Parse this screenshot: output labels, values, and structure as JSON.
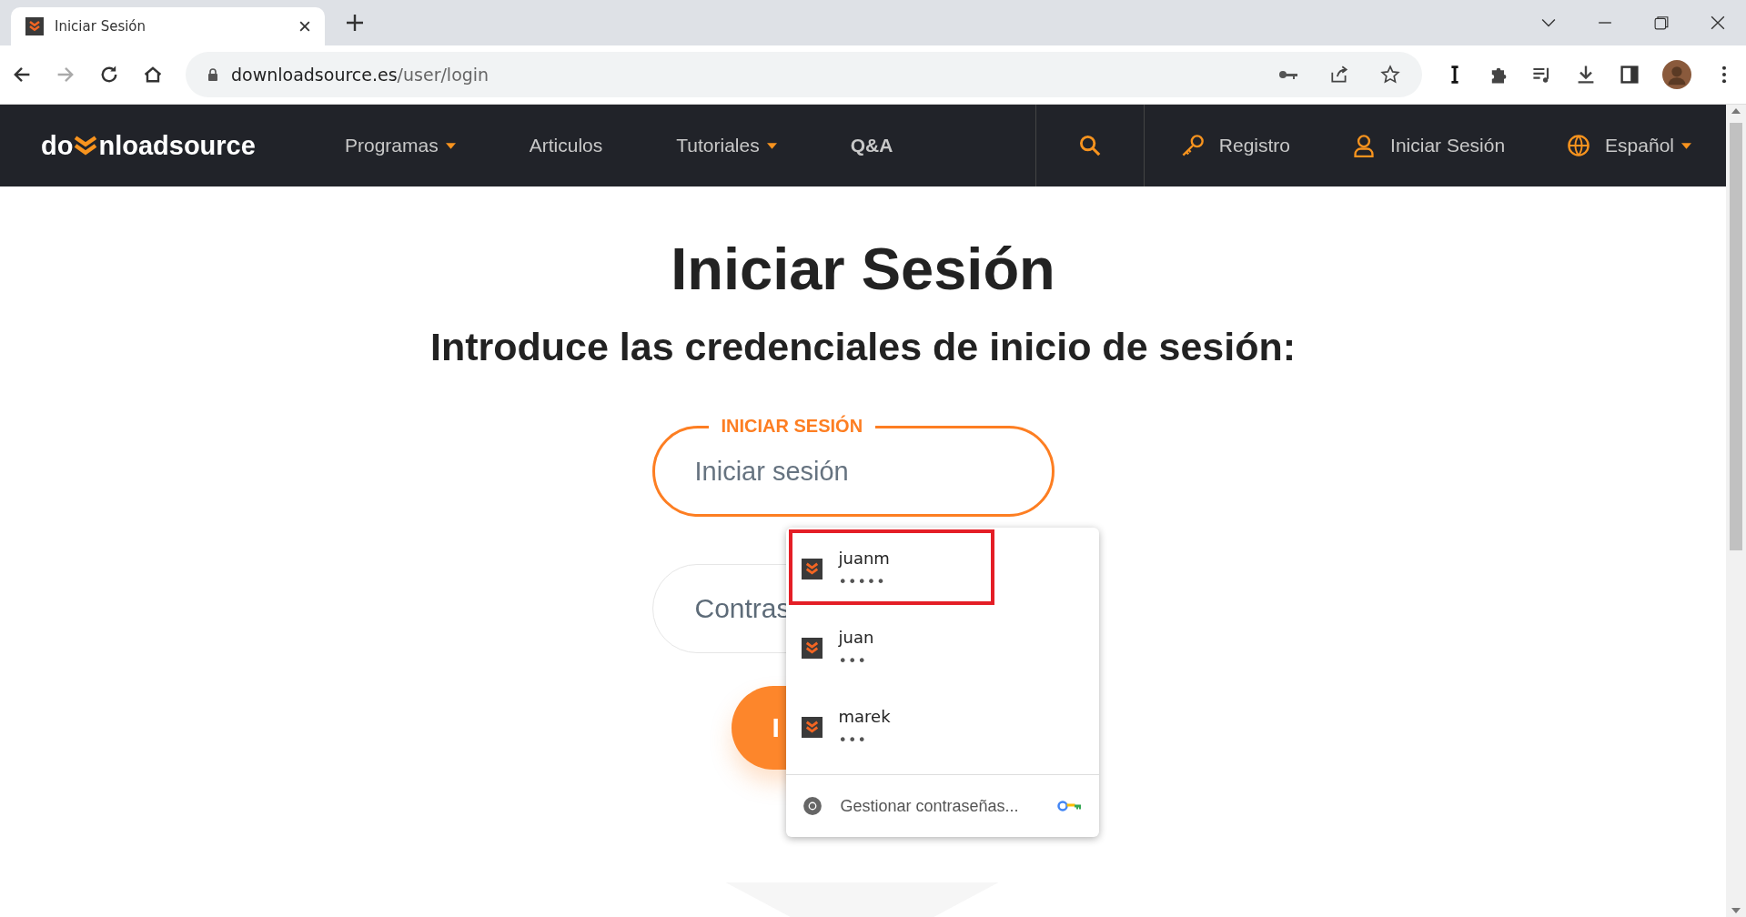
{
  "browser": {
    "tab_title": "Iniciar Sesión",
    "url_host": "downloadsource.es",
    "url_path": "/user/login"
  },
  "nav": {
    "logo_before": "do",
    "logo_after": "nloadsource",
    "items": [
      {
        "label": "Programas",
        "kind": "dropdown"
      },
      {
        "label": "Articulos",
        "kind": "link"
      },
      {
        "label": "Tutoriales",
        "kind": "dropdown"
      },
      {
        "label": "Q&A",
        "kind": "bold"
      }
    ],
    "register": "Registro",
    "login": "Iniciar Sesión",
    "language": "Español"
  },
  "page": {
    "title": "Iniciar Sesión",
    "subtitle": "Introduce las credenciales de inicio de sesión:",
    "login_field": {
      "label": "INICIAR SESIÓN",
      "placeholder": "Iniciar sesión"
    },
    "password_field": {
      "placeholder": "Contras"
    },
    "submit_button": "I"
  },
  "autofill": {
    "suggestions": [
      {
        "username": "juanm",
        "password": "•••••",
        "highlighted": true
      },
      {
        "username": "juan",
        "password": "•••",
        "highlighted": false
      },
      {
        "username": "marek",
        "password": "•••",
        "highlighted": false
      }
    ],
    "manage": "Gestionar contraseñas..."
  }
}
